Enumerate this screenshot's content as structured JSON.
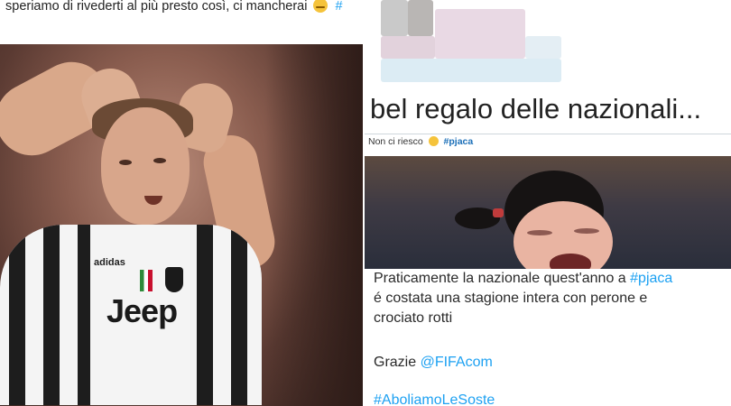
{
  "left_tweet": {
    "text": "speriamo di rivederti al più presto così, ci mancherai",
    "emoji": "expressionless-face-emoji",
    "hashtag_fragment": "#",
    "photo": {
      "jersey_sponsor": "Jeep",
      "jersey_brand": "adidas"
    }
  },
  "right_tweet": {
    "headline": "bel regalo delle nazionali...",
    "reply_text": "Non ci riesco",
    "reply_emoji": "crying-face-emoji",
    "reply_hashtag": "#pjaca",
    "body_line1_pre": "Praticamente la nazionale quest'anno a ",
    "body_line1_tag": "#pjaca",
    "body_line2": "é costata una stagione intera con perone e",
    "body_line3": "crociato rotti",
    "thanks_pre": "Grazie ",
    "thanks_mention": "@FIFAcom",
    "final_hashtag": "#AboliamoLeSoste"
  },
  "colors": {
    "link": "#1da1f2",
    "text": "#222222"
  }
}
